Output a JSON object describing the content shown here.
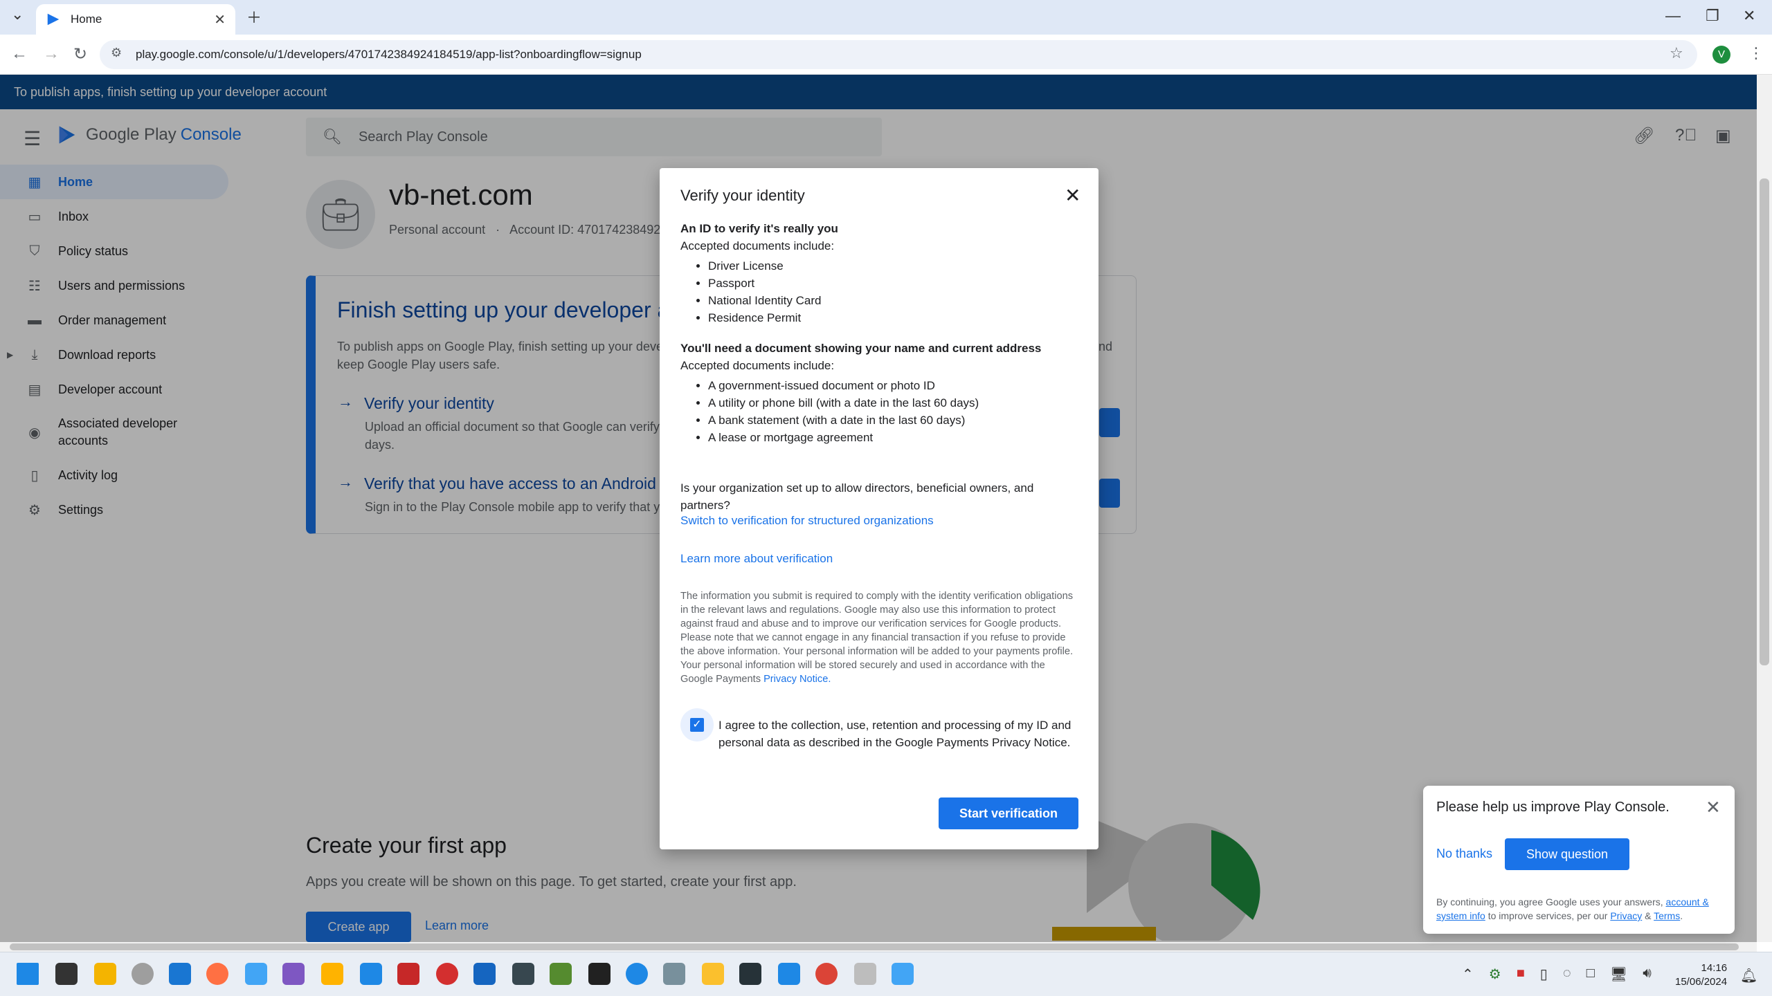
{
  "browser": {
    "tab_title": "Home",
    "url": "play.google.com/console/u/1/developers/4701742384924184519/app-list?onboardingflow=signup",
    "profile_initial": "V"
  },
  "banner": "To publish apps, finish setting up your developer account",
  "header": {
    "logo_google_play": "Google Play",
    "logo_console": "Console",
    "search_placeholder": "Search Play Console"
  },
  "sidebar": {
    "items": [
      {
        "label": "Home",
        "icon": "home-grid-icon"
      },
      {
        "label": "Inbox",
        "icon": "inbox-icon"
      },
      {
        "label": "Policy status",
        "icon": "shield-icon"
      },
      {
        "label": "Users and permissions",
        "icon": "users-icon"
      },
      {
        "label": "Order management",
        "icon": "card-icon"
      },
      {
        "label": "Download reports",
        "icon": "download-icon"
      },
      {
        "label": "Developer account",
        "icon": "briefcase-icon"
      },
      {
        "label": "Associated developer accounts",
        "icon": "linked-accounts-icon"
      },
      {
        "label": "Activity log",
        "icon": "log-icon"
      },
      {
        "label": "Settings",
        "icon": "gear-icon"
      }
    ]
  },
  "account": {
    "name": "vb-net.com",
    "type": "Personal account",
    "id_label": "Account ID: 470174238492"
  },
  "setup": {
    "title": "Finish setting up your developer a",
    "desc_line1": "To publish apps on Google Play, finish setting up your deve",
    "desc_line1_tail": "nd",
    "desc_line2": "keep Google Play users safe.",
    "step1_title": "Verify your identity",
    "step1_desc1": "Upload an official document so that Google can verify",
    "step1_desc2": "days.",
    "step2_title": "Verify that you have access to an Android",
    "step2_desc": "Sign in to the Play Console mobile app to verify that y"
  },
  "create": {
    "title": "Create your first app",
    "desc": "Apps you create will be shown on this page. To get started, create your first app.",
    "create_btn": "Create app",
    "learn_btn": "Learn more"
  },
  "dialog": {
    "title": "Verify your identity",
    "id_heading": "An ID to verify it's really you",
    "accepted_label": "Accepted documents include:",
    "id_docs": [
      "Driver License",
      "Passport",
      "National Identity Card",
      "Residence Permit"
    ],
    "address_heading": "You'll need a document showing your name and current address",
    "accepted_label2": "Accepted documents include:",
    "address_docs": [
      "A government-issued document or photo ID",
      "A utility or phone bill (with a date in the last 60 days)",
      "A bank statement (with a date in the last 60 days)",
      "A lease or mortgage agreement"
    ],
    "org_question": "Is your organization set up to allow directors, beneficial owners, and partners?",
    "org_link": "Switch to verification for structured organizations",
    "learn_link": "Learn more about verification",
    "fine_print": "The information you submit is required to comply with the identity verification obligations in the relevant laws and regulations. Google may also use this information to protect against fraud and abuse and to improve our verification services for Google products. Please note that we cannot engage in any financial transaction if you refuse to provide the above information. Your personal information will be added to your payments profile. Your personal information will be stored securely and used in accordance with the Google Payments",
    "fine_link": "Privacy Notice.",
    "checkbox_label": "I agree to the collection, use, retention and processing of my ID and personal data as described in the Google Payments Privacy Notice.",
    "checkbox_checked": true,
    "start_button": "Start verification"
  },
  "feedback": {
    "title": "Please help us improve Play Console.",
    "no_thanks": "No thanks",
    "show_question": "Show question",
    "note_prefix": "By continuing, you agree Google uses your answers,",
    "note_link1": "account & system info",
    "note_mid": "to improve services, per our",
    "note_link2": "Privacy",
    "note_amp": "&",
    "note_link3": "Terms",
    "note_end": "."
  },
  "taskbar": {
    "time": "14:16",
    "date": "15/06/2024"
  },
  "colors": {
    "accent": "#1a73e8",
    "banner": "#0b4a8a"
  }
}
